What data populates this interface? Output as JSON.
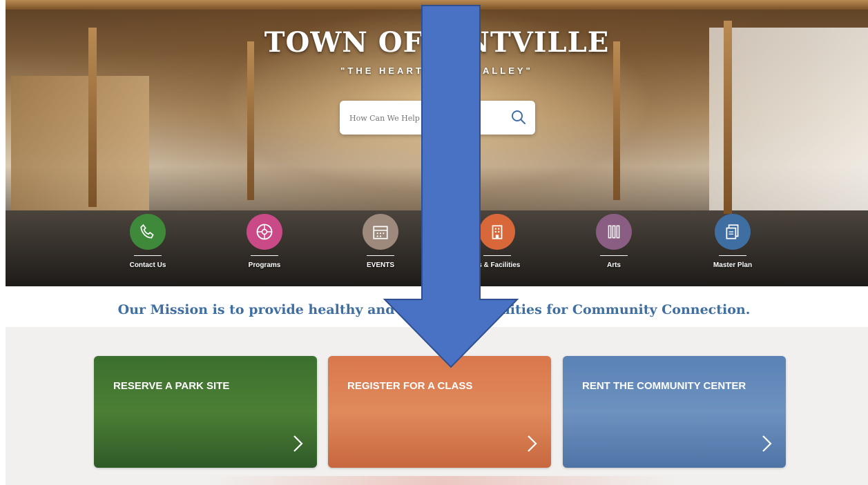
{
  "hero": {
    "title": "TOWN OF Y      NTVILLE",
    "subtitle": "\"THE HEART OF          PA VALLEY\""
  },
  "search": {
    "placeholder": "How Can We Help You?",
    "icon": "search-icon"
  },
  "quick_links": [
    {
      "label": "Contact Us",
      "icon": "phone-icon",
      "color": "#3f8a3a"
    },
    {
      "label": "Programs",
      "icon": "ball-icon",
      "color": "#c94a86"
    },
    {
      "label": "EVENTS",
      "icon": "calendar-icon",
      "color": "#9d8a7c"
    },
    {
      "label": "ks & Facilities",
      "icon": "building-icon",
      "color": "#d8683a"
    },
    {
      "label": "Arts",
      "icon": "art-supplies-icon",
      "color": "#8a5d83"
    },
    {
      "label": "Master Plan",
      "icon": "document-icon",
      "color": "#3f6ea3"
    }
  ],
  "mission": {
    "text_left": "Our Mission is to provide healthy and co",
    "text_right": "rtunities for Community Connection."
  },
  "cards": [
    {
      "title": "RESERVE A PARK SITE",
      "color": "#3f7a34"
    },
    {
      "title": "REGISTER FOR A CLASS",
      "color": "#d9754a"
    },
    {
      "title": "RENT THE COMMUNITY CENTER",
      "color": "#5e86b8"
    }
  ],
  "annotation_arrow": {
    "color": "#4a72c4"
  }
}
